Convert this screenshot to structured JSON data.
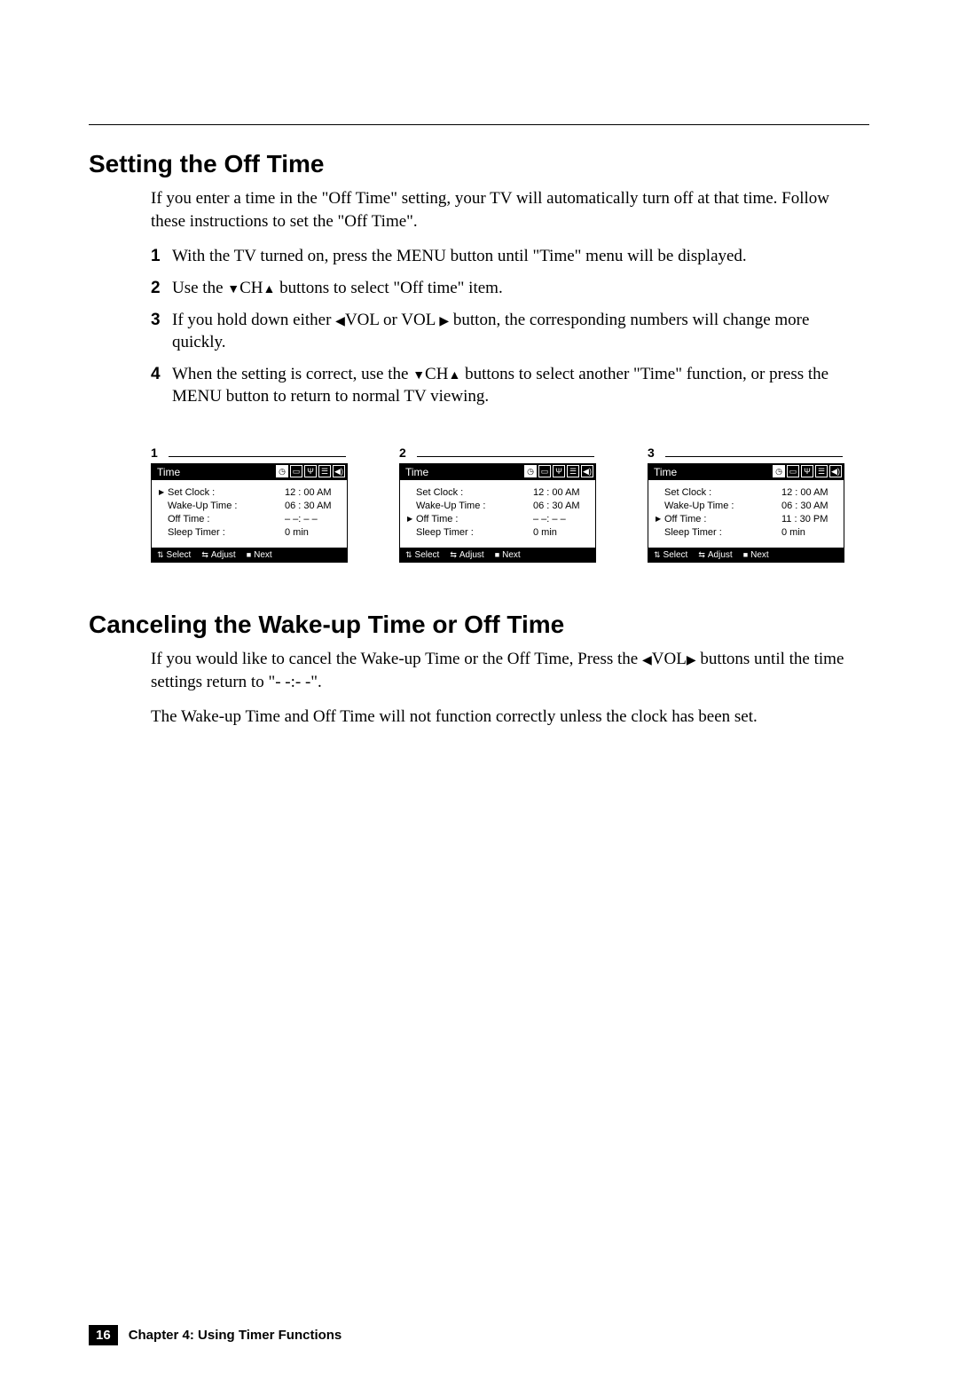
{
  "section1": {
    "heading": "Setting the Off Time",
    "intro": "If you enter a time in the \"Off Time\" setting, your TV will automatically turn off at that time. Follow these instructions to set the \"Off Time\".",
    "steps": [
      {
        "n": "1",
        "a": "With the TV turned on, press the MENU button until \"Time\" menu will be displayed."
      },
      {
        "n": "2",
        "a": "Use the ",
        "b": "CH",
        "c": " buttons to select \"Off time\" item."
      },
      {
        "n": "3",
        "a": "If you hold down either ",
        "b": "VOL or VOL ",
        "c": " button, the corresponding numbers will change more quickly."
      },
      {
        "n": "4",
        "a": "When the setting is correct, use the ",
        "b": "CH",
        "c": " buttons to select another \"Time\" function, or press the MENU button to return to normal TV viewing."
      }
    ]
  },
  "screens": [
    {
      "num": "1",
      "title": "Time",
      "selected_index": 0,
      "rows": [
        {
          "label": "Set Clock :",
          "value": "12 : 00 AM"
        },
        {
          "label": "Wake-Up Time :",
          "value": "06 : 30 AM"
        },
        {
          "label": "Off Time :",
          "value": "– –: – –"
        },
        {
          "label": "Sleep Timer :",
          "value": "0 min"
        }
      ]
    },
    {
      "num": "2",
      "title": "Time",
      "selected_index": 2,
      "rows": [
        {
          "label": "Set Clock :",
          "value": "12 : 00 AM"
        },
        {
          "label": "Wake-Up Time :",
          "value": "06 : 30 AM"
        },
        {
          "label": "Off Time :",
          "value": "– –: – –"
        },
        {
          "label": "Sleep Timer :",
          "value": "0 min"
        }
      ]
    },
    {
      "num": "3",
      "title": "Time",
      "selected_index": 2,
      "rows": [
        {
          "label": "Set Clock :",
          "value": "12 : 00 AM"
        },
        {
          "label": "Wake-Up Time :",
          "value": "06 : 30 AM"
        },
        {
          "label": "Off Time :",
          "value": "11 : 30 PM"
        },
        {
          "label": "Sleep Timer :",
          "value": "0 min"
        }
      ]
    }
  ],
  "osd_footer": {
    "select": "Select",
    "adjust": "Adjust",
    "next": "Next"
  },
  "section2": {
    "heading": "Canceling the Wake-up Time or Off Time",
    "p1a": "If you would like to cancel the Wake-up Time or the Off Time, Press the ",
    "p1b": "VOL",
    "p1c": " buttons until the time settings return to \"- -:- -\".",
    "p2": "The Wake-up Time and Off Time will not function correctly unless the clock has been set."
  },
  "footer": {
    "page": "16",
    "chapter": "Chapter 4: Using Timer Functions"
  }
}
